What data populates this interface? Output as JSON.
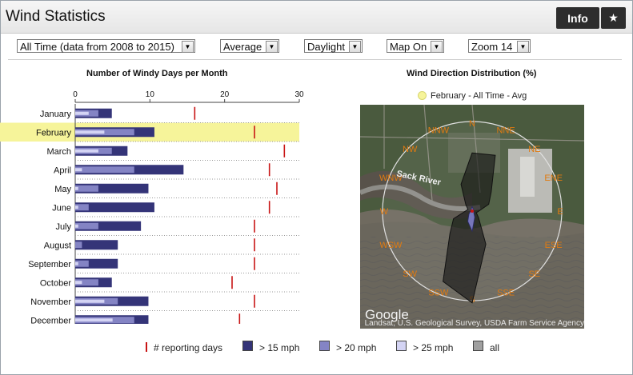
{
  "window": {
    "title": "Wind Statistics",
    "info_label": "Info",
    "star_glyph": "★"
  },
  "filters": {
    "period": "All Time (data from 2008 to 2015)",
    "statistic": "Average",
    "time_of_day": "Daylight",
    "map": "Map On",
    "zoom": "Zoom 14"
  },
  "bar_chart_title": "Number of Windy Days per Month",
  "rose_title": "Wind Direction Distribution (%)",
  "rose_legend": "February - All Time - Avg",
  "selected_month": "February",
  "chart_data": [
    {
      "type": "bar",
      "title": "Number of Windy Days per Month",
      "orientation": "horizontal",
      "stacked": false,
      "xlim": [
        0,
        30
      ],
      "x_ticks": [
        "0",
        "10",
        "20",
        "30"
      ],
      "categories": [
        "January",
        "February",
        "March",
        "April",
        "May",
        "June",
        "July",
        "August",
        "September",
        "October",
        "November",
        "December"
      ],
      "series": [
        {
          "name": "> 15 mph",
          "color": "#343478",
          "values": [
            4.9,
            10.6,
            7.0,
            14.5,
            9.8,
            10.6,
            8.8,
            5.7,
            5.7,
            4.9,
            9.8,
            9.8
          ]
        },
        {
          "name": "> 20 mph",
          "color": "#8484c4",
          "values": [
            3.1,
            7.9,
            4.9,
            7.9,
            3.1,
            1.8,
            3.1,
            0.9,
            1.8,
            3.1,
            5.7,
            7.9
          ]
        },
        {
          "name": "> 25 mph",
          "color": "#d4d4f4",
          "values": [
            1.8,
            3.9,
            3.1,
            0.9,
            0.4,
            0.4,
            0.4,
            0.0,
            0.4,
            0.9,
            3.9,
            5.0
          ]
        },
        {
          "name": "# reporting days",
          "color": "#c81414",
          "values": [
            16,
            24,
            28,
            26,
            27,
            26,
            24,
            24,
            24,
            21,
            24,
            22
          ]
        }
      ],
      "legend": [
        "# reporting days",
        "> 15 mph",
        "> 20 mph",
        "> 25 mph",
        "all"
      ],
      "legend_colors": [
        "#c81414",
        "#343478",
        "#8484c4",
        "#d4d4f4",
        "#a0a0a0"
      ],
      "grid": false
    },
    {
      "type": "radar",
      "title": "Wind Direction Distribution (%)",
      "legend": [
        "February - All Time - Avg"
      ],
      "directions": [
        "N",
        "NNE",
        "NE",
        "ENE",
        "E",
        "ESE",
        "SE",
        "SSE",
        "S",
        "SSW",
        "SW",
        "WSW",
        "W",
        "WNW",
        "NW",
        "NNW"
      ],
      "series": [
        {
          "name": "all",
          "color": "#202020",
          "values": [
            26,
            27,
            12,
            8,
            3,
            2,
            4,
            16,
            41,
            34,
            14,
            9,
            3,
            2,
            4,
            13
          ]
        },
        {
          "name": "> 20 mph",
          "color": "#8080cc",
          "values": [
            2,
            1,
            1,
            0,
            0,
            1,
            1,
            3,
            9,
            5,
            2,
            1,
            0,
            0,
            0,
            1
          ]
        }
      ]
    }
  ],
  "map_labels": {
    "river": "Sack River",
    "provider": "Google",
    "attribution": "Landsat, U.S. Geological Survey, USDA Farm Service Agency"
  },
  "colors": {
    "highlight": "#f6f49a",
    "compass_label": "#e07a10"
  }
}
